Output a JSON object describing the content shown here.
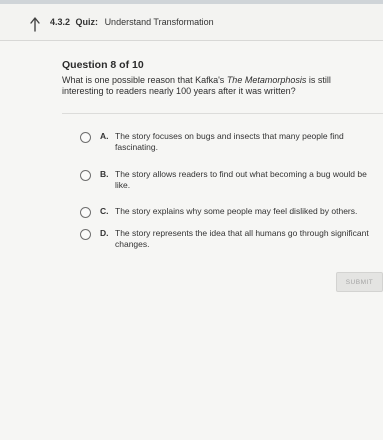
{
  "header": {
    "number": "4.3.2",
    "kind": "Quiz:",
    "title": "Understand Transformation"
  },
  "question": {
    "progress": "Question 8 of 10",
    "text_before": "What is one possible reason that Kafka's ",
    "text_italic": "The Metamorphosis",
    "text_after": " is still interesting to readers nearly 100 years after it was written?"
  },
  "options": [
    {
      "letter": "A.",
      "text": "The story focuses on bugs and insects that many people find fascinating."
    },
    {
      "letter": "B.",
      "text": "The story allows readers to find out what becoming a bug would be like."
    },
    {
      "letter": "C.",
      "text": "The story explains why some people may feel disliked by others."
    },
    {
      "letter": "D.",
      "text": "The story represents the idea that all humans go through significant changes."
    }
  ],
  "submit_label": "SUBMIT",
  "colors": {
    "background": "#f6f6f4",
    "submit_disabled": "#e4e4e2"
  },
  "icons": {
    "back": "back-arrow-icon"
  }
}
